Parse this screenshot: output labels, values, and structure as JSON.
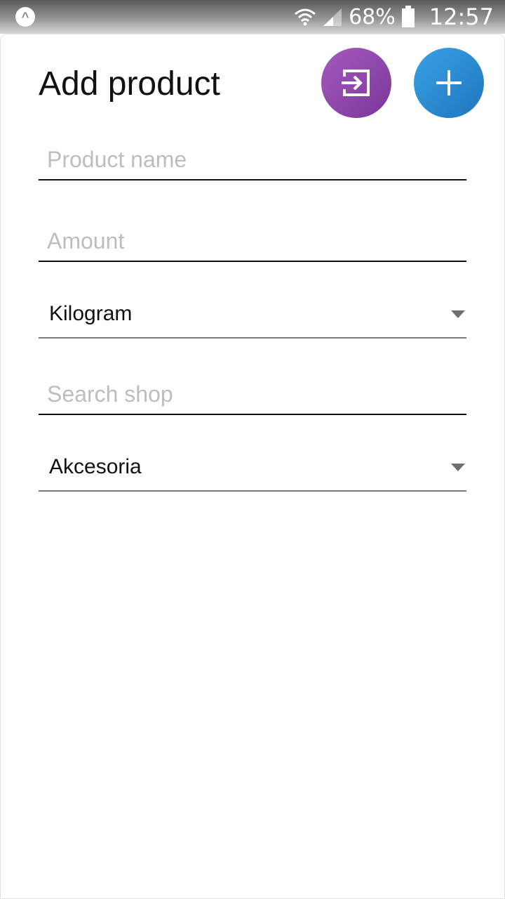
{
  "status_bar": {
    "app_icon_glyph": "^",
    "battery_percent": "68%",
    "time": "12:57",
    "icons": [
      "wifi-icon",
      "signal-icon",
      "battery-icon"
    ]
  },
  "header": {
    "title": "Add product",
    "login_button_icon": "login-icon",
    "add_button_icon": "plus-icon",
    "login_color": "#8e46ad",
    "add_color": "#2b8dd6"
  },
  "form": {
    "product_name": {
      "value": "",
      "placeholder": "Product name"
    },
    "amount": {
      "value": "",
      "placeholder": "Amount"
    },
    "unit_select": {
      "selected": "Kilogram"
    },
    "shop_search": {
      "value": "",
      "placeholder": "Search shop"
    },
    "category_select": {
      "selected": "Akcesoria"
    }
  }
}
